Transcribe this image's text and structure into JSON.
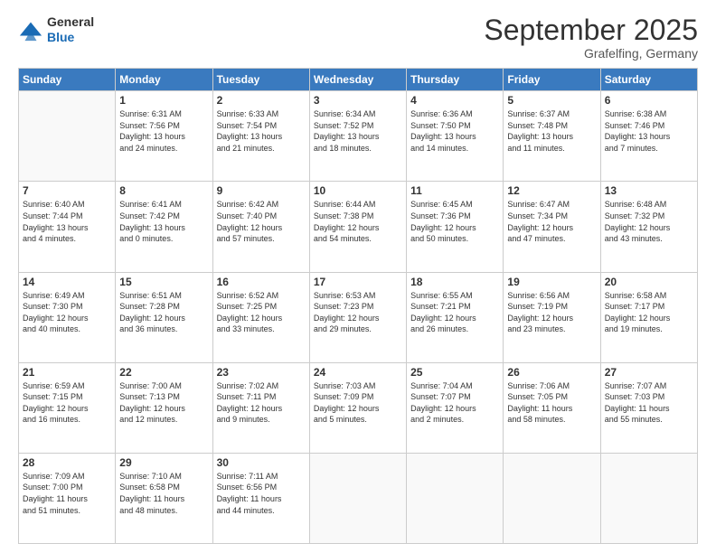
{
  "logo": {
    "line1": "General",
    "line2": "Blue"
  },
  "header": {
    "month": "September 2025",
    "location": "Grafelfing, Germany"
  },
  "weekdays": [
    "Sunday",
    "Monday",
    "Tuesday",
    "Wednesday",
    "Thursday",
    "Friday",
    "Saturday"
  ],
  "weeks": [
    [
      {
        "day": "",
        "info": ""
      },
      {
        "day": "1",
        "info": "Sunrise: 6:31 AM\nSunset: 7:56 PM\nDaylight: 13 hours\nand 24 minutes."
      },
      {
        "day": "2",
        "info": "Sunrise: 6:33 AM\nSunset: 7:54 PM\nDaylight: 13 hours\nand 21 minutes."
      },
      {
        "day": "3",
        "info": "Sunrise: 6:34 AM\nSunset: 7:52 PM\nDaylight: 13 hours\nand 18 minutes."
      },
      {
        "day": "4",
        "info": "Sunrise: 6:36 AM\nSunset: 7:50 PM\nDaylight: 13 hours\nand 14 minutes."
      },
      {
        "day": "5",
        "info": "Sunrise: 6:37 AM\nSunset: 7:48 PM\nDaylight: 13 hours\nand 11 minutes."
      },
      {
        "day": "6",
        "info": "Sunrise: 6:38 AM\nSunset: 7:46 PM\nDaylight: 13 hours\nand 7 minutes."
      }
    ],
    [
      {
        "day": "7",
        "info": "Sunrise: 6:40 AM\nSunset: 7:44 PM\nDaylight: 13 hours\nand 4 minutes."
      },
      {
        "day": "8",
        "info": "Sunrise: 6:41 AM\nSunset: 7:42 PM\nDaylight: 13 hours\nand 0 minutes."
      },
      {
        "day": "9",
        "info": "Sunrise: 6:42 AM\nSunset: 7:40 PM\nDaylight: 12 hours\nand 57 minutes."
      },
      {
        "day": "10",
        "info": "Sunrise: 6:44 AM\nSunset: 7:38 PM\nDaylight: 12 hours\nand 54 minutes."
      },
      {
        "day": "11",
        "info": "Sunrise: 6:45 AM\nSunset: 7:36 PM\nDaylight: 12 hours\nand 50 minutes."
      },
      {
        "day": "12",
        "info": "Sunrise: 6:47 AM\nSunset: 7:34 PM\nDaylight: 12 hours\nand 47 minutes."
      },
      {
        "day": "13",
        "info": "Sunrise: 6:48 AM\nSunset: 7:32 PM\nDaylight: 12 hours\nand 43 minutes."
      }
    ],
    [
      {
        "day": "14",
        "info": "Sunrise: 6:49 AM\nSunset: 7:30 PM\nDaylight: 12 hours\nand 40 minutes."
      },
      {
        "day": "15",
        "info": "Sunrise: 6:51 AM\nSunset: 7:28 PM\nDaylight: 12 hours\nand 36 minutes."
      },
      {
        "day": "16",
        "info": "Sunrise: 6:52 AM\nSunset: 7:25 PM\nDaylight: 12 hours\nand 33 minutes."
      },
      {
        "day": "17",
        "info": "Sunrise: 6:53 AM\nSunset: 7:23 PM\nDaylight: 12 hours\nand 29 minutes."
      },
      {
        "day": "18",
        "info": "Sunrise: 6:55 AM\nSunset: 7:21 PM\nDaylight: 12 hours\nand 26 minutes."
      },
      {
        "day": "19",
        "info": "Sunrise: 6:56 AM\nSunset: 7:19 PM\nDaylight: 12 hours\nand 23 minutes."
      },
      {
        "day": "20",
        "info": "Sunrise: 6:58 AM\nSunset: 7:17 PM\nDaylight: 12 hours\nand 19 minutes."
      }
    ],
    [
      {
        "day": "21",
        "info": "Sunrise: 6:59 AM\nSunset: 7:15 PM\nDaylight: 12 hours\nand 16 minutes."
      },
      {
        "day": "22",
        "info": "Sunrise: 7:00 AM\nSunset: 7:13 PM\nDaylight: 12 hours\nand 12 minutes."
      },
      {
        "day": "23",
        "info": "Sunrise: 7:02 AM\nSunset: 7:11 PM\nDaylight: 12 hours\nand 9 minutes."
      },
      {
        "day": "24",
        "info": "Sunrise: 7:03 AM\nSunset: 7:09 PM\nDaylight: 12 hours\nand 5 minutes."
      },
      {
        "day": "25",
        "info": "Sunrise: 7:04 AM\nSunset: 7:07 PM\nDaylight: 12 hours\nand 2 minutes."
      },
      {
        "day": "26",
        "info": "Sunrise: 7:06 AM\nSunset: 7:05 PM\nDaylight: 11 hours\nand 58 minutes."
      },
      {
        "day": "27",
        "info": "Sunrise: 7:07 AM\nSunset: 7:03 PM\nDaylight: 11 hours\nand 55 minutes."
      }
    ],
    [
      {
        "day": "28",
        "info": "Sunrise: 7:09 AM\nSunset: 7:00 PM\nDaylight: 11 hours\nand 51 minutes."
      },
      {
        "day": "29",
        "info": "Sunrise: 7:10 AM\nSunset: 6:58 PM\nDaylight: 11 hours\nand 48 minutes."
      },
      {
        "day": "30",
        "info": "Sunrise: 7:11 AM\nSunset: 6:56 PM\nDaylight: 11 hours\nand 44 minutes."
      },
      {
        "day": "",
        "info": ""
      },
      {
        "day": "",
        "info": ""
      },
      {
        "day": "",
        "info": ""
      },
      {
        "day": "",
        "info": ""
      }
    ]
  ]
}
